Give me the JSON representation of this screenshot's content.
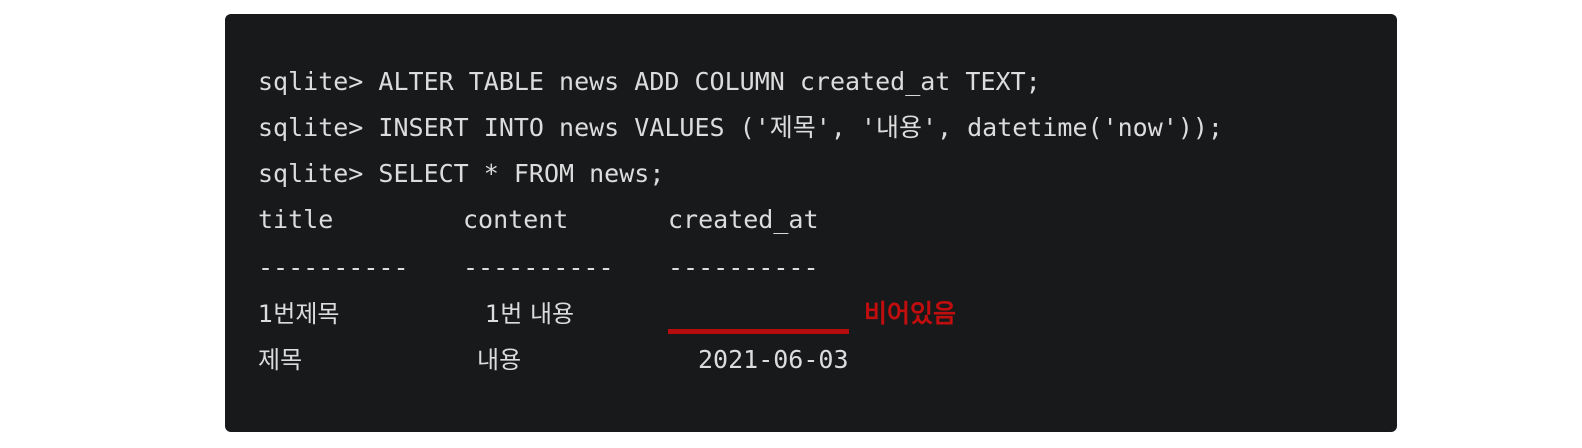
{
  "terminal": {
    "commands": [
      "sqlite> ALTER TABLE news ADD COLUMN created_at TEXT;",
      "sqlite> INSERT INTO news VALUES ('제목', '내용', datetime('now'));",
      "sqlite> SELECT * FROM news;"
    ],
    "table": {
      "headers": [
        "title",
        "content",
        "created_at"
      ],
      "separators": [
        "----------",
        "----------",
        "----------"
      ],
      "rows": [
        [
          "1번제목",
          "1번 내용",
          ""
        ],
        [
          "제목",
          "내용",
          "2021-06-03"
        ]
      ]
    }
  },
  "annotation": {
    "label": "비어있음",
    "color": "#c10d0d"
  }
}
